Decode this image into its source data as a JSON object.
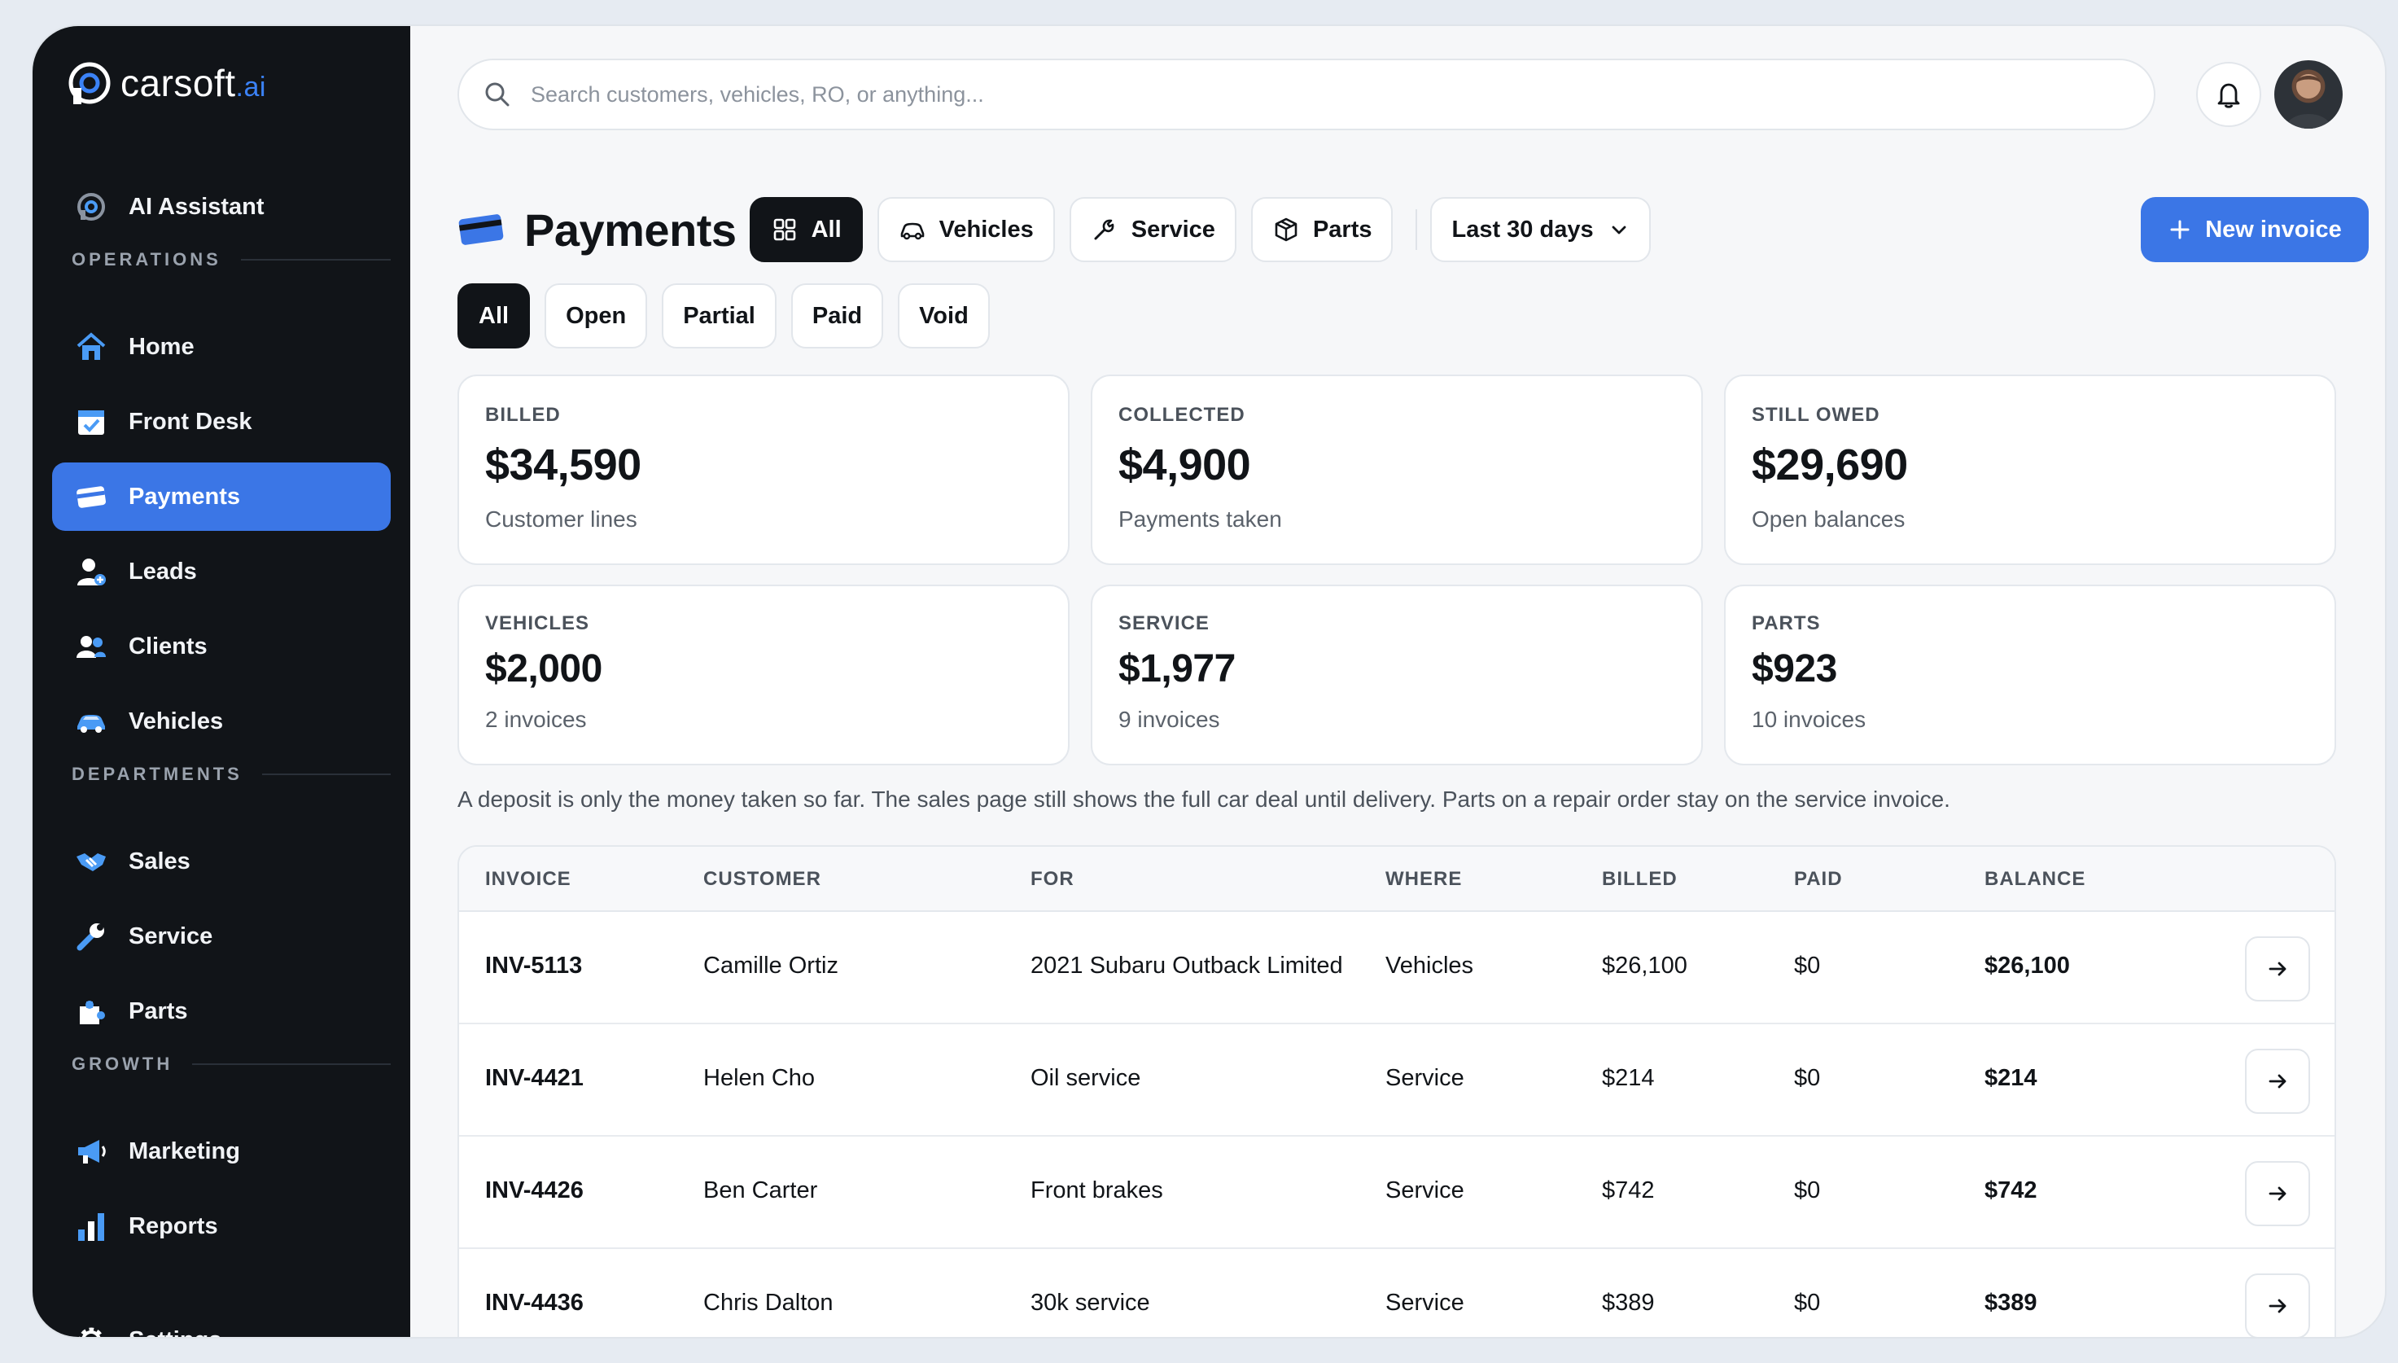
{
  "brand": {
    "name": "carsoft",
    "suffix": ".ai"
  },
  "sidebar": {
    "assistant": "AI Assistant",
    "sections": {
      "operations": "OPERATIONS",
      "departments": "DEPARTMENTS",
      "growth": "GROWTH"
    },
    "items": {
      "home": "Home",
      "front_desk": "Front Desk",
      "payments": "Payments",
      "leads": "Leads",
      "clients": "Clients",
      "vehicles": "Vehicles",
      "sales": "Sales",
      "service": "Service",
      "parts": "Parts",
      "marketing": "Marketing",
      "reports": "Reports",
      "settings": "Settings"
    }
  },
  "search": {
    "placeholder": "Search customers, vehicles, RO, or anything..."
  },
  "header": {
    "title": "Payments",
    "tabs": [
      "All",
      "Vehicles",
      "Service",
      "Parts"
    ],
    "range": "Last 30 days",
    "new_invoice": "New invoice"
  },
  "filters": [
    "All",
    "Open",
    "Partial",
    "Paid",
    "Void"
  ],
  "stats": [
    {
      "label": "BILLED",
      "value": "$34,590",
      "sub": "Customer lines"
    },
    {
      "label": "COLLECTED",
      "value": "$4,900",
      "sub": "Payments taken"
    },
    {
      "label": "STILL OWED",
      "value": "$29,690",
      "sub": "Open balances"
    },
    {
      "label": "VEHICLES",
      "value": "$2,000",
      "sub": "2 invoices"
    },
    {
      "label": "SERVICE",
      "value": "$1,977",
      "sub": "9 invoices"
    },
    {
      "label": "PARTS",
      "value": "$923",
      "sub": "10 invoices"
    }
  ],
  "note": "A deposit is only the money taken so far. The sales page still shows the full car deal until delivery. Parts on a repair order stay on the service invoice.",
  "table": {
    "columns": [
      "INVOICE",
      "CUSTOMER",
      "FOR",
      "WHERE",
      "BILLED",
      "PAID",
      "BALANCE"
    ],
    "rows": [
      {
        "invoice": "INV-5113",
        "customer": "Camille Ortiz",
        "for": "2021 Subaru Outback Limited",
        "where": "Vehicles",
        "billed": "$26,100",
        "paid": "$0",
        "balance": "$26,100"
      },
      {
        "invoice": "INV-4421",
        "customer": "Helen Cho",
        "for": "Oil service",
        "where": "Service",
        "billed": "$214",
        "paid": "$0",
        "balance": "$214"
      },
      {
        "invoice": "INV-4426",
        "customer": "Ben Carter",
        "for": "Front brakes",
        "where": "Service",
        "billed": "$742",
        "paid": "$0",
        "balance": "$742"
      },
      {
        "invoice": "INV-4436",
        "customer": "Chris Dalton",
        "for": "30k service",
        "where": "Service",
        "billed": "$389",
        "paid": "$0",
        "balance": "$389"
      }
    ]
  },
  "colors": {
    "accent": "#3b76e6",
    "sidebar_bg": "#111418",
    "icon_blue": "#4a9bf5"
  }
}
